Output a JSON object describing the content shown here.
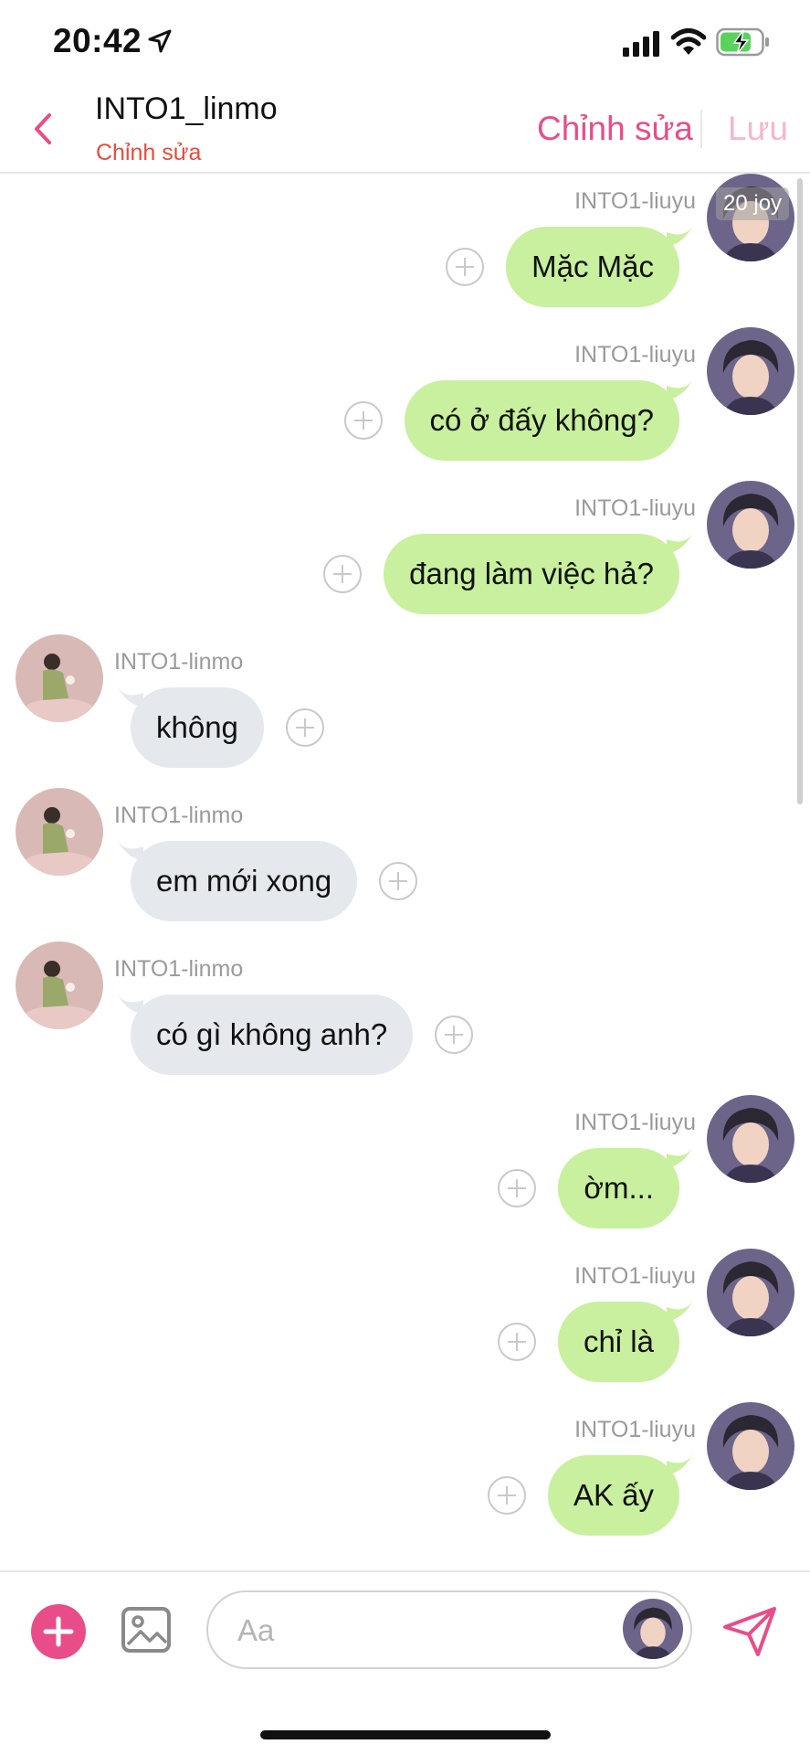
{
  "status_bar": {
    "time": "20:42"
  },
  "header": {
    "title": "INTO1_linmo",
    "subtitle": "Chỉnh sửa",
    "edit_label": "Chỉnh sửa",
    "save_label": "Lưu"
  },
  "time_badge": "20 joy",
  "messages": [
    {
      "side": "out",
      "sender": "INTO1-liuyu",
      "text": "Mặc Mặc"
    },
    {
      "side": "out",
      "sender": "INTO1-liuyu",
      "text": "có ở đấy không?"
    },
    {
      "side": "out",
      "sender": "INTO1-liuyu",
      "text": "đang làm việc hả?"
    },
    {
      "side": "in",
      "sender": "INTO1-linmo",
      "text": "không"
    },
    {
      "side": "in",
      "sender": "INTO1-linmo",
      "text": "em mới xong"
    },
    {
      "side": "in",
      "sender": "INTO1-linmo",
      "text": "có gì không anh?"
    },
    {
      "side": "out",
      "sender": "INTO1-liuyu",
      "text": "ờm..."
    },
    {
      "side": "out",
      "sender": "INTO1-liuyu",
      "text": "chỉ là"
    },
    {
      "side": "out",
      "sender": "INTO1-liuyu",
      "text": "AK ấy"
    }
  ],
  "composer": {
    "placeholder": "Aa"
  },
  "colors": {
    "accent": "#e84d8a",
    "outgoing_bubble": "#c8f09e",
    "incoming_bubble": "#e5e8ec",
    "subtitle": "#e74c3c"
  }
}
